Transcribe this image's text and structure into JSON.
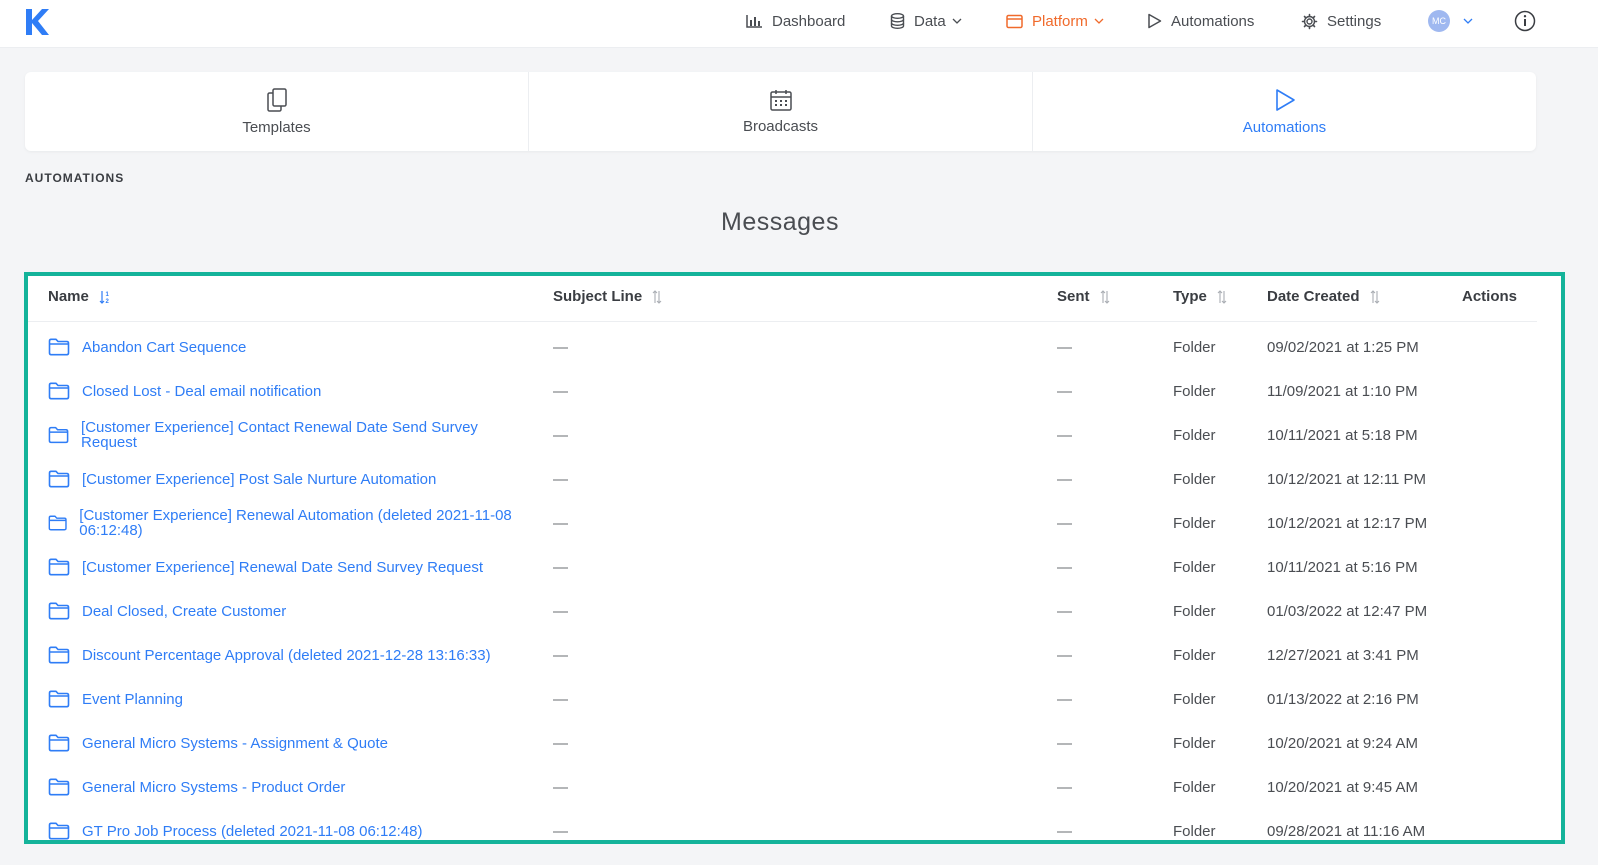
{
  "topbar": {
    "logo_letter": "K",
    "nav": [
      {
        "label": "Dashboard",
        "icon": "bar-chart-icon",
        "active": false,
        "dropdown": false
      },
      {
        "label": "Data",
        "icon": "database-icon",
        "active": false,
        "dropdown": true
      },
      {
        "label": "Platform",
        "icon": "window-icon",
        "active": true,
        "dropdown": true
      },
      {
        "label": "Automations",
        "icon": "play-icon",
        "active": false,
        "dropdown": false
      },
      {
        "label": "Settings",
        "icon": "gear-icon",
        "active": false,
        "dropdown": false
      }
    ],
    "avatar_initials": "MC",
    "accent_color": "#f06a2b"
  },
  "tabs": [
    {
      "label": "Templates",
      "icon": "copy-icon",
      "active": false
    },
    {
      "label": "Broadcasts",
      "icon": "calendar-icon",
      "active": false
    },
    {
      "label": "Automations",
      "icon": "play-icon",
      "active": true
    }
  ],
  "section_label": "AUTOMATIONS",
  "page_title": "Messages",
  "table": {
    "columns": [
      "Name",
      "Subject Line",
      "Sent",
      "Type",
      "Date Created",
      "Actions"
    ],
    "rows": [
      {
        "name": "Abandon Cart Sequence",
        "subject": "—",
        "sent": "—",
        "type": "Folder",
        "date": "09/02/2021 at 1:25 PM"
      },
      {
        "name": "Closed Lost - Deal email notification",
        "subject": "—",
        "sent": "—",
        "type": "Folder",
        "date": "11/09/2021 at 1:10 PM"
      },
      {
        "name": "[Customer Experience] Contact Renewal Date Send Survey Request",
        "subject": "—",
        "sent": "—",
        "type": "Folder",
        "date": "10/11/2021 at 5:18 PM"
      },
      {
        "name": "[Customer Experience] Post Sale Nurture Automation",
        "subject": "—",
        "sent": "—",
        "type": "Folder",
        "date": "10/12/2021 at 12:11 PM"
      },
      {
        "name": "[Customer Experience] Renewal Automation (deleted 2021-11-08 06:12:48)",
        "subject": "—",
        "sent": "—",
        "type": "Folder",
        "date": "10/12/2021 at 12:17 PM"
      },
      {
        "name": "[Customer Experience] Renewal Date Send Survey Request",
        "subject": "—",
        "sent": "—",
        "type": "Folder",
        "date": "10/11/2021 at 5:16 PM"
      },
      {
        "name": "Deal Closed, Create Customer",
        "subject": "—",
        "sent": "—",
        "type": "Folder",
        "date": "01/03/2022 at 12:47 PM"
      },
      {
        "name": "Discount Percentage Approval (deleted 2021-12-28 13:16:33)",
        "subject": "—",
        "sent": "—",
        "type": "Folder",
        "date": "12/27/2021 at 3:41 PM"
      },
      {
        "name": "Event Planning",
        "subject": "—",
        "sent": "—",
        "type": "Folder",
        "date": "01/13/2022 at 2:16 PM"
      },
      {
        "name": "General Micro Systems - Assignment & Quote",
        "subject": "—",
        "sent": "—",
        "type": "Folder",
        "date": "10/20/2021 at 9:24 AM"
      },
      {
        "name": "General Micro Systems - Product Order",
        "subject": "—",
        "sent": "—",
        "type": "Folder",
        "date": "10/20/2021 at 9:45 AM"
      },
      {
        "name": "GT Pro Job Process (deleted 2021-11-08 06:12:48)",
        "subject": "—",
        "sent": "—",
        "type": "Folder",
        "date": "09/28/2021 at 11:16 AM"
      }
    ]
  },
  "colors": {
    "link": "#2f7df6",
    "highlight_border": "#14b39a"
  }
}
